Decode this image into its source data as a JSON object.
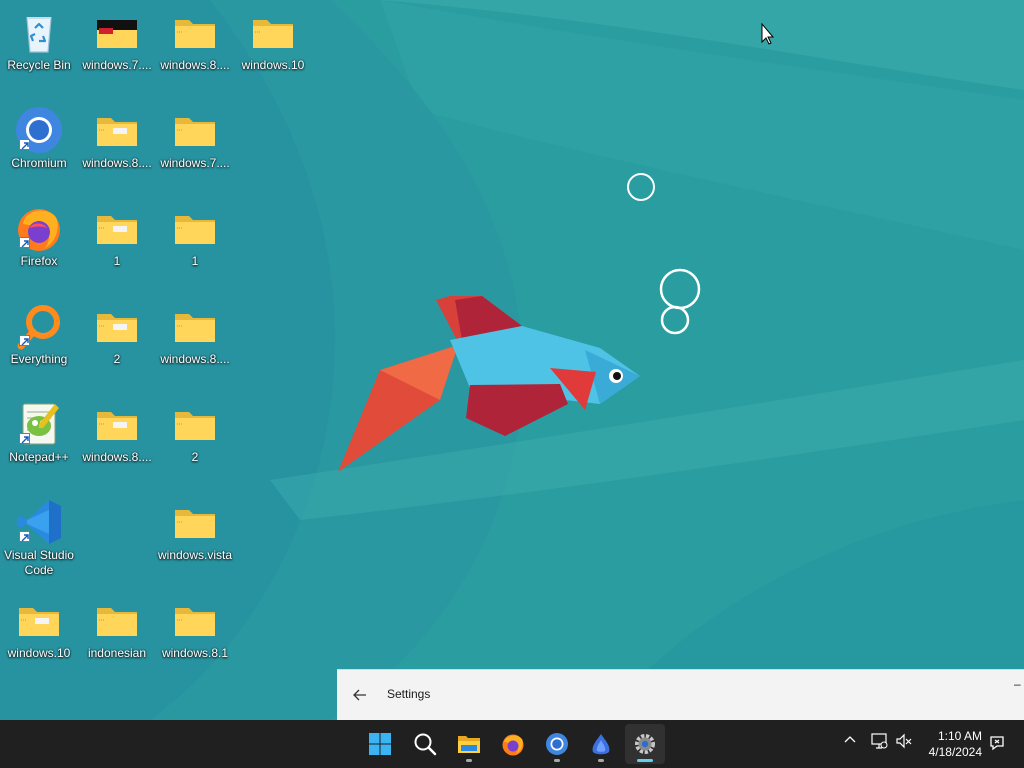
{
  "desktop": {
    "icons": [
      {
        "label": "Recycle Bin",
        "type": "recycle"
      },
      {
        "label": "Chromium",
        "type": "chromium"
      },
      {
        "label": "Firefox",
        "type": "firefox"
      },
      {
        "label": "Everything",
        "type": "everything"
      },
      {
        "label": "Notepad++",
        "type": "notepadpp"
      },
      {
        "label": "Visual Studio Code",
        "type": "vscode"
      },
      {
        "label": "windows.10",
        "type": "folder-zip"
      },
      {
        "label": "windows.7....",
        "type": "folder-dark"
      },
      {
        "label": "windows.8....",
        "type": "folder-zip"
      },
      {
        "label": "1",
        "type": "folder-zip"
      },
      {
        "label": "2",
        "type": "folder-zip"
      },
      {
        "label": "windows.8....",
        "type": "folder-zip"
      },
      {
        "label": "indonesian",
        "type": "folder-zip"
      },
      {
        "label": "windows.8....",
        "type": "folder-zip"
      },
      {
        "label": "windows.7....",
        "type": "folder-zip"
      },
      {
        "label": "1",
        "type": "folder-zip"
      },
      {
        "label": "windows.8....",
        "type": "folder-zip"
      },
      {
        "label": "2",
        "type": "folder-zip"
      },
      {
        "label": "windows.vista",
        "type": "folder-zip"
      },
      {
        "label": "windows.8.1",
        "type": "folder-zip"
      },
      {
        "label": "windows.10",
        "type": "folder-zip"
      }
    ]
  },
  "settings_window": {
    "title": "Settings",
    "minimize_glyph": "–"
  },
  "taskbar": {
    "apps": [
      {
        "name": "Start",
        "icon": "windows-logo-icon",
        "running": false,
        "active": false
      },
      {
        "name": "Search",
        "icon": "search-icon",
        "running": false,
        "active": false
      },
      {
        "name": "File Explorer",
        "icon": "file-explorer-icon",
        "running": true,
        "active": false
      },
      {
        "name": "Firefox",
        "icon": "firefox-icon",
        "running": false,
        "active": false
      },
      {
        "name": "Chromium",
        "icon": "chromium-icon",
        "running": true,
        "active": false
      },
      {
        "name": "App",
        "icon": "blue-app-icon",
        "running": true,
        "active": false
      },
      {
        "name": "Settings",
        "icon": "gear-icon",
        "running": true,
        "active": true
      }
    ],
    "clock": {
      "time": "1:10 AM",
      "date": "4/18/2024"
    }
  },
  "colors": {
    "wallpaper": "#2b9ea0",
    "taskbar": "#202020",
    "accent": "#5fd0f0"
  }
}
